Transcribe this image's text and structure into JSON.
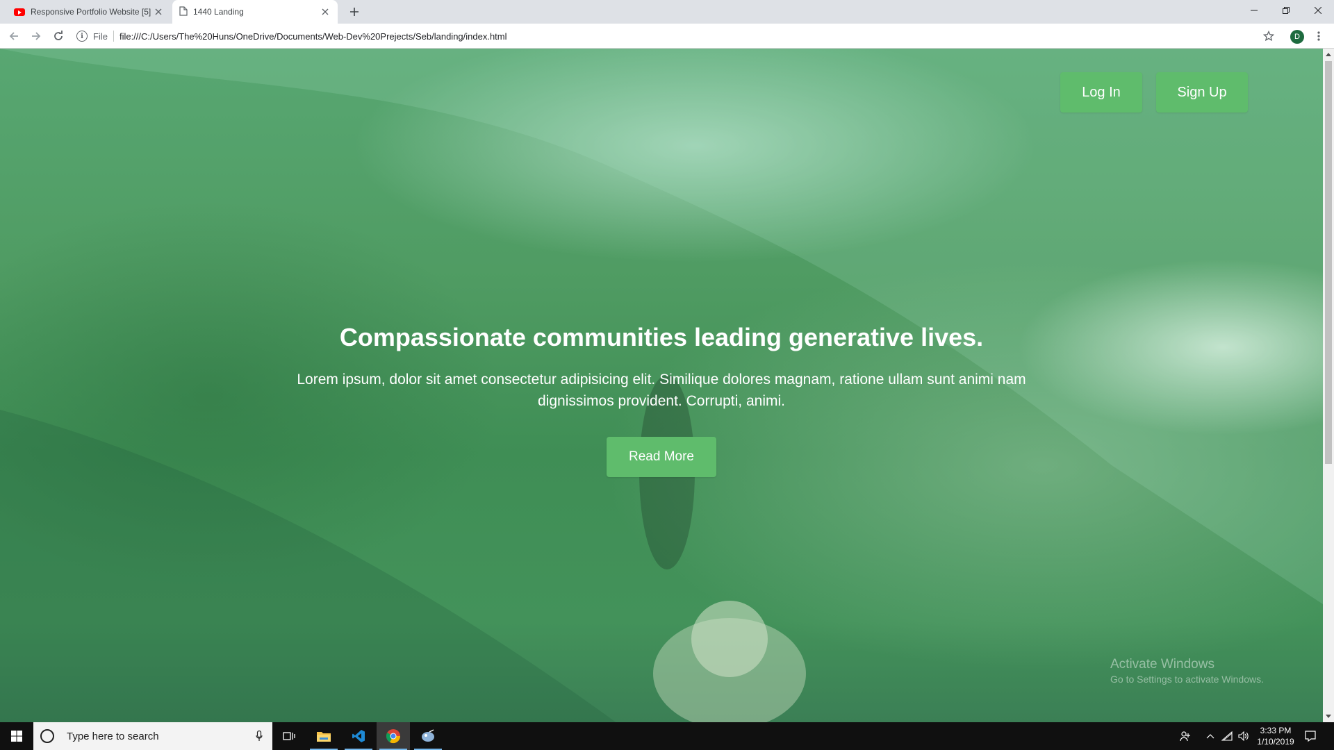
{
  "browser": {
    "tabs": [
      {
        "title": "Responsive Portfolio Website [5]",
        "icon": "youtube-icon",
        "active": false
      },
      {
        "title": "1440 Landing",
        "icon": "page-icon",
        "active": true
      }
    ],
    "omnibox": {
      "scheme_label": "File",
      "url": "file:///C:/Users/The%20Huns/OneDrive/Documents/Web-Dev%20Prejects/Seb/landing/index.html"
    },
    "profile_initial": "D"
  },
  "page": {
    "nav": {
      "login_label": "Log In",
      "signup_label": "Sign Up"
    },
    "hero": {
      "title": "Compassionate communities leading generative lives.",
      "text": "Lorem ipsum, dolor sit amet consectetur adipisicing elit. Similique dolores magnam, ratione ullam sunt animi nam dignissimos provident. Corrupti, animi.",
      "button_label": "Read More"
    },
    "accent_color": "#5fbc6c",
    "watermark": {
      "line1": "Activate Windows",
      "line2": "Go to Settings to activate Windows."
    }
  },
  "taskbar": {
    "search_placeholder": "Type here to search",
    "apps": [
      "task-view-icon",
      "file-explorer-icon",
      "vscode-icon",
      "chrome-icon",
      "app-icon"
    ],
    "time": "3:33 PM",
    "date": "1/10/2019"
  }
}
